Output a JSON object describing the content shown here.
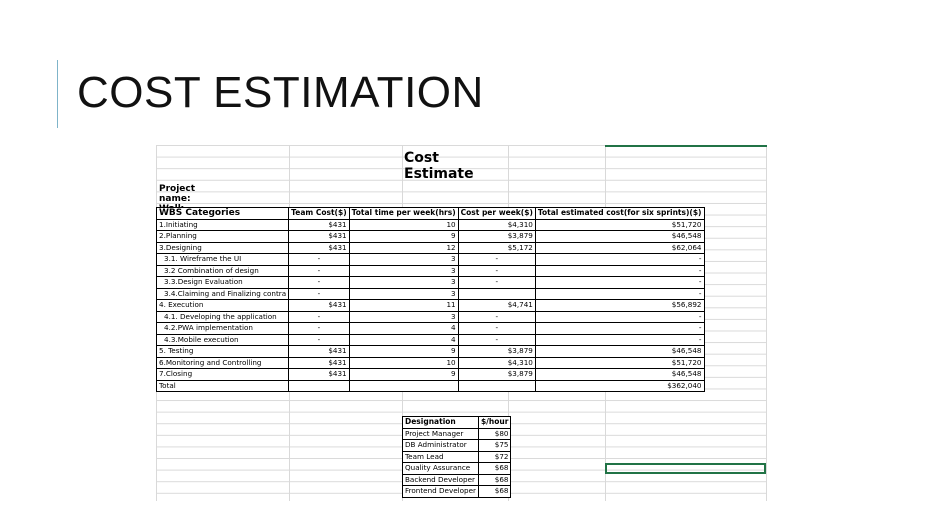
{
  "slide": {
    "title": "COST ESTIMATION"
  },
  "sheet": {
    "title": "Cost Estimate",
    "project_name": "Project name: Walk Tracker",
    "headers": [
      "WBS Categories",
      "Team Cost($)",
      "Total time per week(hrs)",
      "Cost per week($)",
      "Total estimated cost(for six sprints)($)"
    ],
    "rows": [
      {
        "name": "1.Initiating",
        "team_cost": "$431",
        "hours": "10",
        "cost_week": "$4,310",
        "total": "$51,720",
        "sub": false
      },
      {
        "name": "2.Planning",
        "team_cost": "$431",
        "hours": "9",
        "cost_week": "$3,879",
        "total": "$46,548",
        "sub": false
      },
      {
        "name": "3.Designing",
        "team_cost": "$431",
        "hours": "12",
        "cost_week": "$5,172",
        "total": "$62,064",
        "sub": false
      },
      {
        "name": "3.1. Wireframe the UI",
        "team_cost": "-",
        "hours": "3",
        "cost_week": "-",
        "total": "-",
        "sub": true
      },
      {
        "name": "3.2 Combination of design",
        "team_cost": "-",
        "hours": "3",
        "cost_week": "-",
        "total": "-",
        "sub": true
      },
      {
        "name": "3.3.Design Evaluation",
        "team_cost": "-",
        "hours": "3",
        "cost_week": "-",
        "total": "-",
        "sub": true
      },
      {
        "name": "3.4.Claiming and Finalizing contra",
        "team_cost": "-",
        "hours": "3",
        "cost_week": "",
        "total": "-",
        "sub": true
      },
      {
        "name": "4. Execution",
        "team_cost": "$431",
        "hours": "11",
        "cost_week": "$4,741",
        "total": "$56,892",
        "sub": false
      },
      {
        "name": "4.1. Developing the application",
        "team_cost": "-",
        "hours": "3",
        "cost_week": "-",
        "total": "-",
        "sub": true
      },
      {
        "name": "4.2.PWA implementation",
        "team_cost": "-",
        "hours": "4",
        "cost_week": "-",
        "total": "-",
        "sub": true
      },
      {
        "name": "4.3.Mobile execution",
        "team_cost": "-",
        "hours": "4",
        "cost_week": "-",
        "total": "-",
        "sub": true
      },
      {
        "name": "5. Testing",
        "team_cost": "$431",
        "hours": "9",
        "cost_week": "$3,879",
        "total": "$46,548",
        "sub": false
      },
      {
        "name": "6.Monitoring and Controlling",
        "team_cost": "$431",
        "hours": "10",
        "cost_week": "$4,310",
        "total": "$51,720",
        "sub": false
      },
      {
        "name": "7.Closing",
        "team_cost": "$431",
        "hours": "9",
        "cost_week": "$3,879",
        "total": "$46,548",
        "sub": false
      },
      {
        "name": "Total",
        "team_cost": "",
        "hours": "",
        "cost_week": "",
        "total": "$362,040",
        "sub": false
      }
    ],
    "rates": {
      "headers": [
        "Designation",
        "$/hour"
      ],
      "rows": [
        {
          "role": "Project Manager",
          "rate": "$80"
        },
        {
          "role": "DB Administrator",
          "rate": "$75"
        },
        {
          "role": "Team Lead",
          "rate": "$72"
        },
        {
          "role": "Quality Assurance",
          "rate": "$68"
        },
        {
          "role": "Backend Developer",
          "rate": "$68"
        },
        {
          "role": "Frontend Developer",
          "rate": "$68"
        }
      ]
    }
  },
  "colors": {
    "accent_line": "#7fb4c9",
    "selection": "#217346",
    "gridline": "#d9d9d9"
  }
}
